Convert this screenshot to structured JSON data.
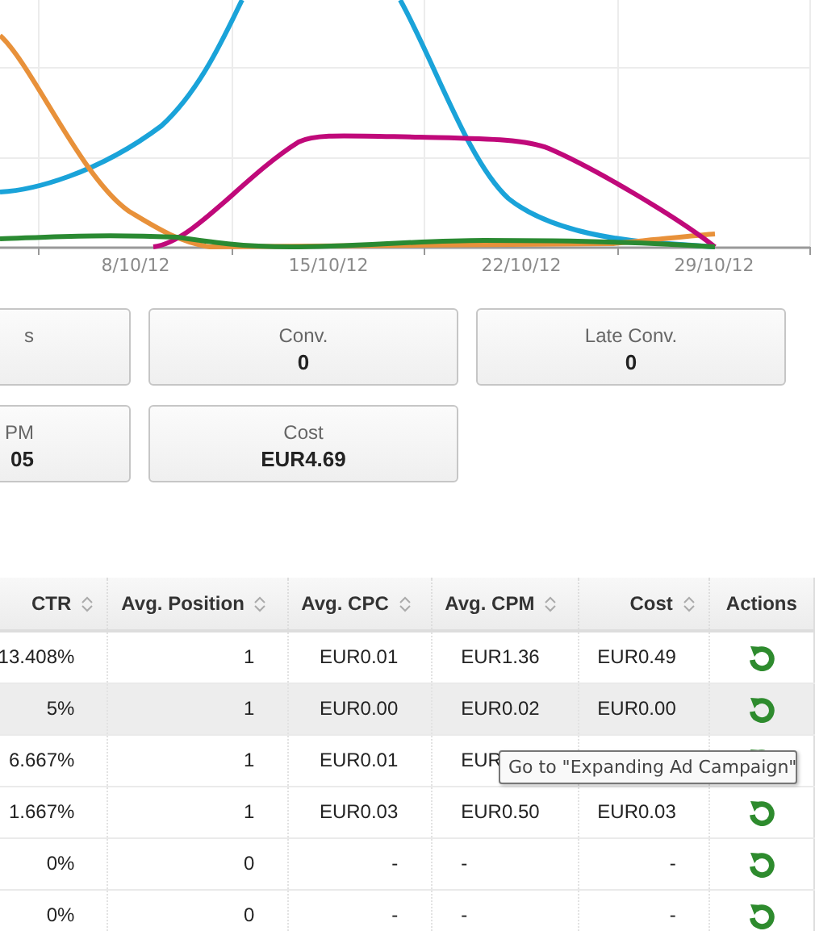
{
  "chart": {
    "x_labels": [
      "8/10/12",
      "15/10/12",
      "22/10/12",
      "29/10/12"
    ],
    "series": [
      {
        "color": "#1aa3d9"
      },
      {
        "color": "#e8913a"
      },
      {
        "color": "#c0097a"
      },
      {
        "color": "#2a8a32"
      }
    ]
  },
  "stat_cards": [
    [
      {
        "label": "s"
      },
      {
        "label": "Conv.",
        "value": "0"
      },
      {
        "label": "Late Conv.",
        "value": "0"
      }
    ],
    [
      {
        "label": "PM",
        "value": "05"
      },
      {
        "label": "Cost",
        "value": "EUR4.69"
      }
    ]
  ],
  "table": {
    "columns": [
      {
        "label": "CTR",
        "sortable": true
      },
      {
        "label": "Avg. Position",
        "sortable": true
      },
      {
        "label": "Avg. CPC",
        "sortable": true
      },
      {
        "label": "Avg. CPM",
        "sortable": true
      },
      {
        "label": "Cost",
        "sortable": true
      },
      {
        "label": "Actions",
        "sortable": false
      }
    ],
    "rows": [
      {
        "cells": [
          "13.408%",
          "1",
          "EUR0.01",
          "EUR1.36",
          "EUR0.49"
        ],
        "highlighted": false
      },
      {
        "cells": [
          "5%",
          "1",
          "EUR0.00",
          "EUR0.02",
          "EUR0.00"
        ],
        "highlighted": true
      },
      {
        "cells": [
          "6.667%",
          "1",
          "EUR0.01",
          "EUR"
        ],
        "highlighted": false
      },
      {
        "cells": [
          "1.667%",
          "1",
          "EUR0.03",
          "EUR0.50",
          "EUR0.03"
        ],
        "highlighted": false
      },
      {
        "cells": [
          "0%",
          "0",
          "-",
          "-",
          "-"
        ],
        "highlighted": false
      },
      {
        "cells": [
          "0%",
          "0",
          "-",
          "-",
          "-"
        ],
        "highlighted": false
      }
    ],
    "tooltip": "Go to \"Expanding Ad Campaign\""
  }
}
